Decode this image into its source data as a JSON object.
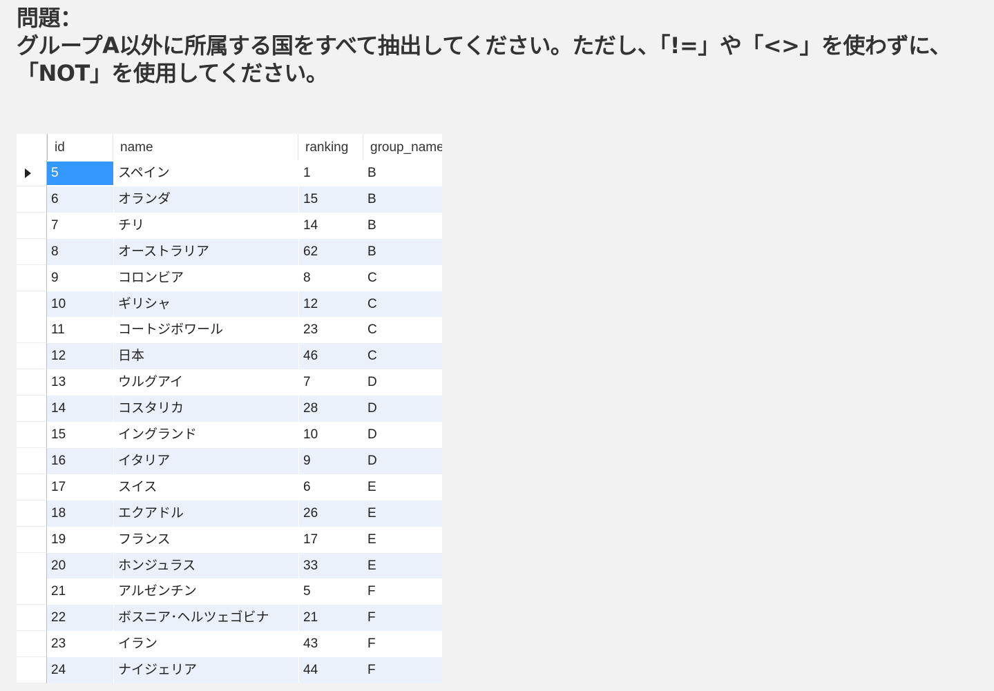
{
  "question": {
    "heading": "問題：",
    "body": "グループA以外に所属する国をすべて抽出してください。ただし、「!=」や「<>」を使わずに、「NOT」を使用してください。"
  },
  "grid": {
    "columns": [
      "id",
      "name",
      "ranking",
      "group_name"
    ],
    "selected_row_index": 0,
    "rows": [
      {
        "id": "5",
        "name": "スペイン",
        "ranking": "1",
        "group_name": "B"
      },
      {
        "id": "6",
        "name": "オランダ",
        "ranking": "15",
        "group_name": "B"
      },
      {
        "id": "7",
        "name": "チリ",
        "ranking": "14",
        "group_name": "B"
      },
      {
        "id": "8",
        "name": "オーストラリア",
        "ranking": "62",
        "group_name": "B"
      },
      {
        "id": "9",
        "name": "コロンビア",
        "ranking": "8",
        "group_name": "C"
      },
      {
        "id": "10",
        "name": "ギリシャ",
        "ranking": "12",
        "group_name": "C"
      },
      {
        "id": "11",
        "name": "コートジボワール",
        "ranking": "23",
        "group_name": "C"
      },
      {
        "id": "12",
        "name": "日本",
        "ranking": "46",
        "group_name": "C"
      },
      {
        "id": "13",
        "name": "ウルグアイ",
        "ranking": "7",
        "group_name": "D"
      },
      {
        "id": "14",
        "name": "コスタリカ",
        "ranking": "28",
        "group_name": "D"
      },
      {
        "id": "15",
        "name": "イングランド",
        "ranking": "10",
        "group_name": "D"
      },
      {
        "id": "16",
        "name": "イタリア",
        "ranking": "9",
        "group_name": "D"
      },
      {
        "id": "17",
        "name": "スイス",
        "ranking": "6",
        "group_name": "E"
      },
      {
        "id": "18",
        "name": "エクアドル",
        "ranking": "26",
        "group_name": "E"
      },
      {
        "id": "19",
        "name": "フランス",
        "ranking": "17",
        "group_name": "E"
      },
      {
        "id": "20",
        "name": "ホンジュラス",
        "ranking": "33",
        "group_name": "E"
      },
      {
        "id": "21",
        "name": "アルゼンチン",
        "ranking": "5",
        "group_name": "F"
      },
      {
        "id": "22",
        "name": "ボスニア･ヘルツェゴビナ",
        "ranking": "21",
        "group_name": "F"
      },
      {
        "id": "23",
        "name": "イラン",
        "ranking": "43",
        "group_name": "F"
      },
      {
        "id": "24",
        "name": "ナイジェリア",
        "ranking": "44",
        "group_name": "F"
      }
    ]
  }
}
